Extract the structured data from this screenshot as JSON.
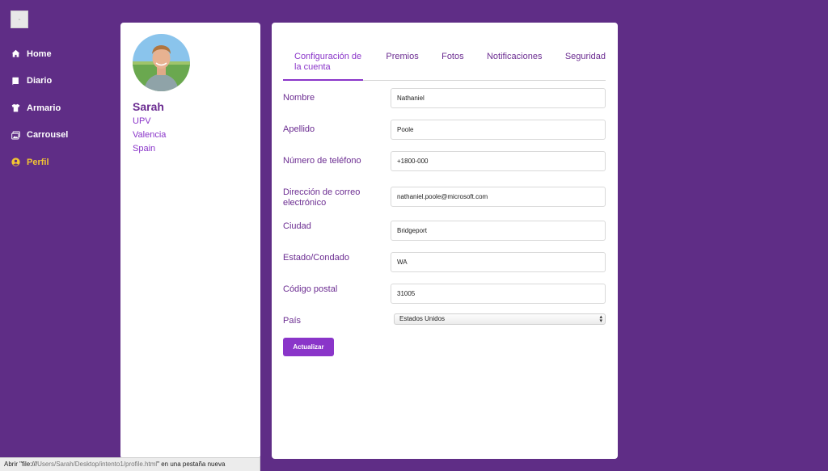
{
  "logo": {
    "text": "m"
  },
  "sidebar": {
    "items": [
      {
        "label": "Home",
        "icon": "home-icon"
      },
      {
        "label": "Diario",
        "icon": "book-icon"
      },
      {
        "label": "Armario",
        "icon": "shirt-icon"
      },
      {
        "label": "Carrousel",
        "icon": "images-icon"
      },
      {
        "label": "Perfil",
        "icon": "user-circle-icon",
        "active": true
      }
    ]
  },
  "profile": {
    "name": "Sarah",
    "university": "UPV",
    "city": "Valencia",
    "country": "Spain"
  },
  "tabs": [
    {
      "label": "Configuración de la cuenta",
      "active": true
    },
    {
      "label": "Premios"
    },
    {
      "label": "Fotos"
    },
    {
      "label": "Notificaciones"
    },
    {
      "label": "Seguridad"
    }
  ],
  "form": {
    "fields": [
      {
        "label": "Nombre",
        "value": "Nathaniel"
      },
      {
        "label": "Apellido",
        "value": "Poole"
      },
      {
        "label": "Número de teléfono",
        "value": "+1800-000"
      },
      {
        "label": "Dirección de correo electrónico",
        "value": "nathaniel.poole@microsoft.com"
      },
      {
        "label": "Ciudad",
        "value": "Bridgeport"
      },
      {
        "label": "Estado/Condado",
        "value": "WA"
      },
      {
        "label": "Código postal",
        "value": "31005"
      }
    ],
    "country_label": "País",
    "country_value": "Estados Unidos",
    "submit_label": "Actualizar"
  },
  "statusbar": {
    "prefix": "Abrir \"",
    "scheme": "file:///",
    "path": "Users/Sarah/Desktop/intento1/profile.html",
    "suffix": "\" en una pestaña nueva"
  },
  "colors": {
    "background": "#5f2d86",
    "accent": "#8a35c9",
    "label": "#6b2c91",
    "active_nav": "#f3c531"
  }
}
